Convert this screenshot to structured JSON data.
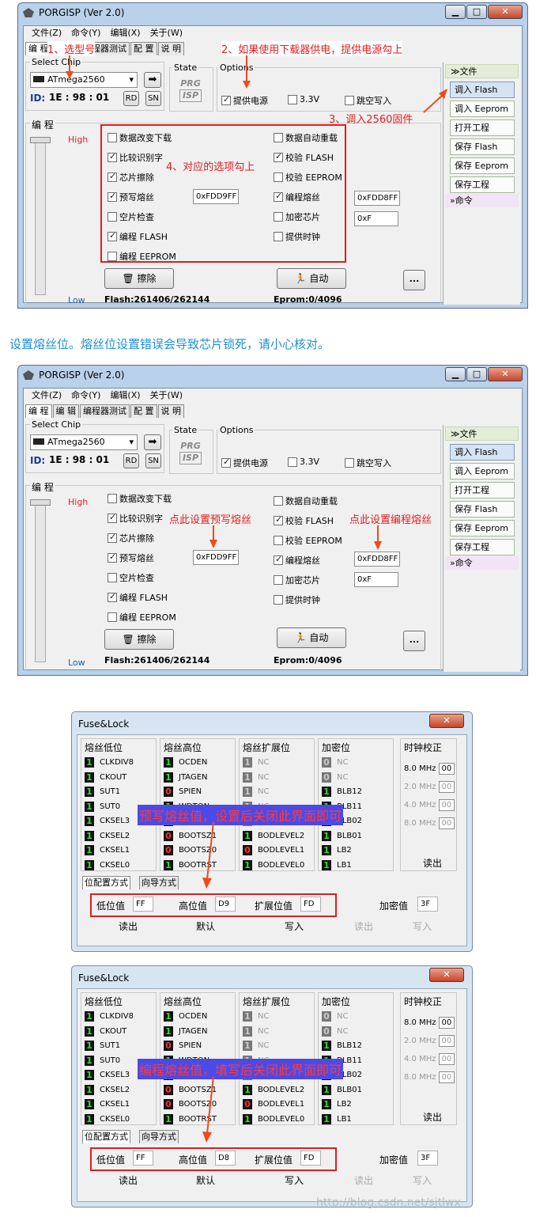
{
  "app_title": "PORGISP (Ver 2.0)",
  "window_buttons": {
    "min": "▁",
    "max": "□",
    "close": "✕"
  },
  "menu": [
    "文件(Z)",
    "命令(Y)",
    "编辑(X)",
    "关于(W)"
  ],
  "tabs": [
    "编 程",
    "编 辑",
    "编程器测试",
    "配 置",
    "说 明"
  ],
  "select_chip": {
    "label": "Select Chip",
    "value": "ATmega2560"
  },
  "id_label": "ID:",
  "id_value": "1E : 98 : 01",
  "rd_label": "RD",
  "sn_label": "SN",
  "state_label": "State",
  "prg_logo": "PRG",
  "isp_logo": "ISP",
  "options_label": "Options",
  "options": {
    "power": "提供电源",
    "v33": "3.3V",
    "skip_empty": "跳空写入"
  },
  "program_group_label": "编 程",
  "high_label": "High",
  "low_label": "Low",
  "checks_left": [
    "数据改变下载",
    "比较识别字",
    "芯片擦除",
    "预写熔丝",
    "空片检查",
    "编程 FLASH",
    "编程 EEPROM"
  ],
  "checks_left_state": [
    false,
    true,
    true,
    true,
    false,
    true,
    false
  ],
  "checks_right": [
    "数据自动重载",
    "校验 FLASH",
    "校验 EEPROM",
    "编程熔丝",
    "加密芯片",
    "提供时钟"
  ],
  "checks_right_state": [
    false,
    true,
    false,
    true,
    false,
    false
  ],
  "prewrite_fuse_value": "0xFDD9FF",
  "program_fuse_value": "0xFDD8FF",
  "lock_value": "0xF",
  "erase_label": "擦除",
  "auto_label": "自动",
  "more_label": "...",
  "flash_status": "Flash:261406/262144",
  "eprom_status": "Eprom:0/4096",
  "sidebar": {
    "file_header": "文件",
    "buttons": [
      "调入 Flash",
      "调入 Eeprom",
      "打开工程",
      "保存 Flash",
      "保存 Eeprom",
      "保存工程"
    ],
    "cmd_header": "命令"
  },
  "annotations1": {
    "step1": "1、选型号",
    "step2": "2、如果使用下载器供电，提供电源勾上",
    "step3": "3、调入2560固件",
    "step4": "4、对应的选项勾上"
  },
  "middle_text": "设置熔丝位。熔丝位设置错误会导致芯片锁死，请小心核对。",
  "annotations2": {
    "prewrite": "点此设置预写熔丝",
    "program": "点此设置编程熔丝"
  },
  "fuse_dialog": {
    "title": "Fuse&Lock",
    "headers": [
      "熔丝低位",
      "熔丝高位",
      "熔丝扩展位",
      "加密位",
      "时钟校正"
    ],
    "low_bits": [
      [
        "1",
        "CLKDIV8"
      ],
      [
        "1",
        "CKOUT"
      ],
      [
        "1",
        "SUT1"
      ],
      [
        "1",
        "SUT0"
      ],
      [
        "1",
        "CKSEL3"
      ],
      [
        "1",
        "CKSEL2"
      ],
      [
        "1",
        "CKSEL1"
      ],
      [
        "1",
        "CKSEL0"
      ]
    ],
    "high_bits": [
      [
        "1",
        "OCDEN"
      ],
      [
        "1",
        "JTAGEN"
      ],
      [
        "0",
        "SPIEN"
      ],
      [
        "1",
        "WDTON"
      ],
      [
        "1",
        "EESAVE"
      ],
      [
        "0",
        "BOOTSZ1"
      ],
      [
        "0",
        "BOOTSZ0"
      ],
      [
        "1",
        "BOOTRST"
      ]
    ],
    "ext_bits": [
      [
        "1",
        "NC"
      ],
      [
        "1",
        "NC"
      ],
      [
        "1",
        "NC"
      ],
      [
        "1",
        "NC"
      ],
      [
        "1",
        "NC"
      ],
      [
        "1",
        "BODLEVEL2"
      ],
      [
        "0",
        "BODLEVEL1"
      ],
      [
        "1",
        "BODLEVEL0"
      ]
    ],
    "lock_bits": [
      [
        "0",
        "NC"
      ],
      [
        "0",
        "NC"
      ],
      [
        "1",
        "BLB12"
      ],
      [
        "1",
        "BLB11"
      ],
      [
        "1",
        "BLB02"
      ],
      [
        "1",
        "BLB01"
      ],
      [
        "1",
        "LB2"
      ],
      [
        "1",
        "LB1"
      ]
    ],
    "clock": [
      [
        "8.0 MHz",
        "00"
      ],
      [
        "2.0 MHz",
        "00"
      ],
      [
        "4.0 MHz",
        "00"
      ],
      [
        "8.0 MHz",
        "00"
      ]
    ],
    "clock_read": "读出",
    "tab_bits": "位配置方式",
    "tab_wizard": "向导方式",
    "low_label": "低位值",
    "high_label": "高位值",
    "ext_label": "扩展位值",
    "lock_label": "加密值",
    "low_value": "FF",
    "ext_value": "FD",
    "lock_value": "3F",
    "read": "读出",
    "default": "默认",
    "write": "写入",
    "lock_read": "读出",
    "lock_write": "写入"
  },
  "fuse1_high_value": "D9",
  "fuse2_high_value": "D8",
  "fuse1_note": "预写熔丝值，设置后关闭此界面即可",
  "fuse2_note": "编程熔丝值，填写后关闭此界面即可",
  "watermark": "http://blog.csdn.net/sjtlwx"
}
